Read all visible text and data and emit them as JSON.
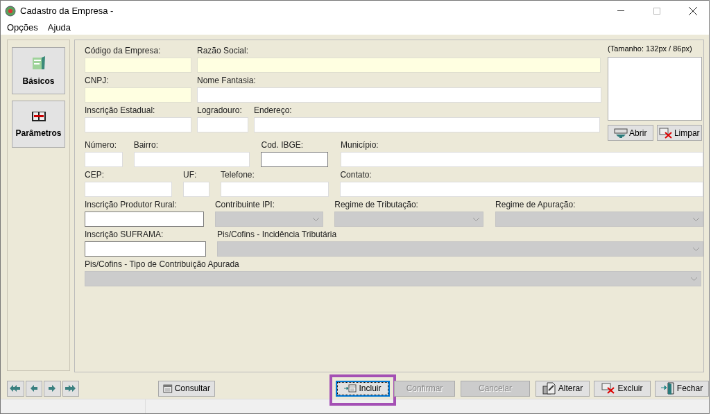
{
  "window": {
    "title": "Cadastro da Empresa -"
  },
  "menu": [
    "Opções",
    "Ajuda"
  ],
  "sidebar": [
    {
      "label": "Básicos",
      "kind": "sheet"
    },
    {
      "label": "Parâmetros",
      "kind": "book"
    }
  ],
  "image_panel": {
    "caption": "(Tamanho: 132px / 86px)",
    "buttons": [
      {
        "label": "Abrir",
        "kind": "open"
      },
      {
        "label": "Limpar",
        "kind": "clear"
      }
    ]
  },
  "top_rows": [
    [
      {
        "label": "Código da Empresa:",
        "kind": "required"
      },
      {
        "label": "Razão Social:",
        "kind": "required"
      }
    ],
    [
      {
        "label": "CNPJ:",
        "kind": "required"
      },
      {
        "label": "Nome Fantasia:",
        "kind": "text"
      }
    ],
    [
      {
        "label": "Inscrição Estadual:",
        "kind": "text"
      },
      {
        "label": "Logradouro:",
        "kind": "text"
      },
      {
        "label": "Endereço:",
        "kind": "text"
      }
    ]
  ],
  "rows": [
    [
      {
        "label": "Número:",
        "kind": "text"
      },
      {
        "label": "Bairro:",
        "kind": "text"
      },
      {
        "label": "Cod. IBGE:",
        "kind": "framed"
      },
      {
        "label": "Município:",
        "kind": "text"
      }
    ],
    [
      {
        "label": "CEP:",
        "kind": "text"
      },
      {
        "label": "UF:",
        "kind": "text"
      },
      {
        "label": "Telefone:",
        "kind": "text"
      },
      {
        "label": "Contato:",
        "kind": "text"
      }
    ],
    [
      {
        "label": "Inscrição Produtor Rural:",
        "kind": "framed"
      },
      {
        "label": "Contribuinte IPI:",
        "kind": "select"
      },
      {
        "label": "Regime de Tributação:",
        "kind": "select"
      },
      {
        "label": "Regime de Apuração:",
        "kind": "select"
      }
    ],
    [
      {
        "label": "Inscrição SUFRAMA:",
        "kind": "framed"
      },
      {
        "label": "Pis/Cofins - Incidência Tributária",
        "kind": "select"
      }
    ],
    [
      {
        "label": "Pis/Cofins - Tipo de Contribuição Apurada",
        "kind": "select"
      }
    ]
  ],
  "nav_buttons": [
    {
      "kind": "first"
    },
    {
      "kind": "prev"
    },
    {
      "kind": "next"
    },
    {
      "kind": "last"
    }
  ],
  "actions": [
    {
      "label": "Consultar",
      "kind": "query",
      "disabled": false,
      "focused": false
    },
    {
      "label": "Incluir",
      "kind": "add",
      "disabled": false,
      "focused": true
    },
    {
      "label": "Confirmar",
      "kind": "none",
      "disabled": true,
      "focused": false
    },
    {
      "label": "Cancelar",
      "kind": "none",
      "disabled": true,
      "focused": false
    },
    {
      "label": "Alterar",
      "kind": "edit",
      "disabled": false,
      "focused": false
    },
    {
      "label": "Excluir",
      "kind": "delete",
      "disabled": false,
      "focused": false
    },
    {
      "label": "Fechar",
      "kind": "exit",
      "disabled": false,
      "focused": false
    }
  ]
}
